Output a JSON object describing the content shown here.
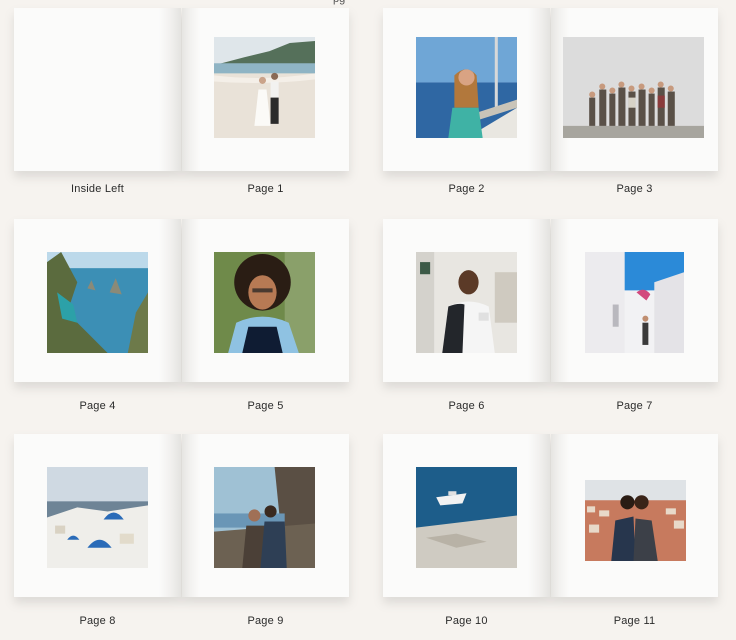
{
  "top_fragment": "pg",
  "pages": {
    "inside_left": "Inside Left",
    "p1": "Page 1",
    "p2": "Page 2",
    "p3": "Page 3",
    "p4": "Page 4",
    "p5": "Page 5",
    "p6": "Page 6",
    "p7": "Page 7",
    "p8": "Page 8",
    "p9": "Page 9",
    "p10": "Page 10",
    "p11": "Page 11"
  },
  "colors": {
    "background": "#f6f3ef",
    "page": "#fbfbfa",
    "label_text": "#2b2b2b"
  }
}
